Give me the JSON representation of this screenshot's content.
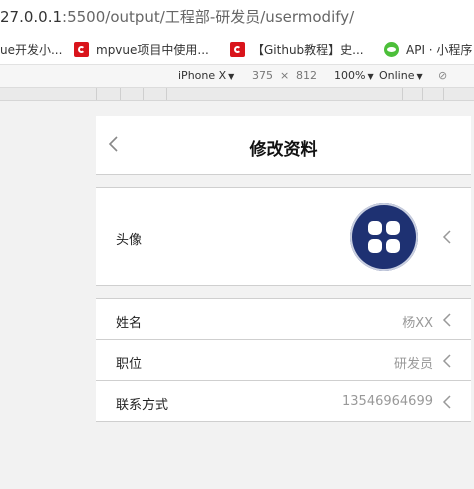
{
  "browser": {
    "url_host": "27.0.0.1",
    "url_rest": ":5500/output/工程部-研发员/usermodify/",
    "bookmarks": [
      {
        "label": "ue开发小...",
        "icon": "none"
      },
      {
        "label": "mpvue项目中使用...",
        "icon": "csdn-icon"
      },
      {
        "label": "【Github教程】史...",
        "icon": "csdn-icon"
      },
      {
        "label": "API · 小程序",
        "icon": "wechat-icon"
      }
    ],
    "device_toolbar": {
      "device": "iPhone X",
      "width": "375",
      "times": "×",
      "height": "812",
      "zoom": "100%",
      "network": "Online"
    }
  },
  "page": {
    "title": "修改资料",
    "avatar_row": {
      "label": "头像"
    },
    "fields": [
      {
        "label": "姓名",
        "value": "杨XX"
      },
      {
        "label": "职位",
        "value": "研发员"
      },
      {
        "label": "联系方式",
        "value": "13546964699"
      }
    ]
  },
  "colors": {
    "avatar_bg": "#1e3172",
    "value_text": "#999999",
    "background": "#f2f2f2"
  }
}
